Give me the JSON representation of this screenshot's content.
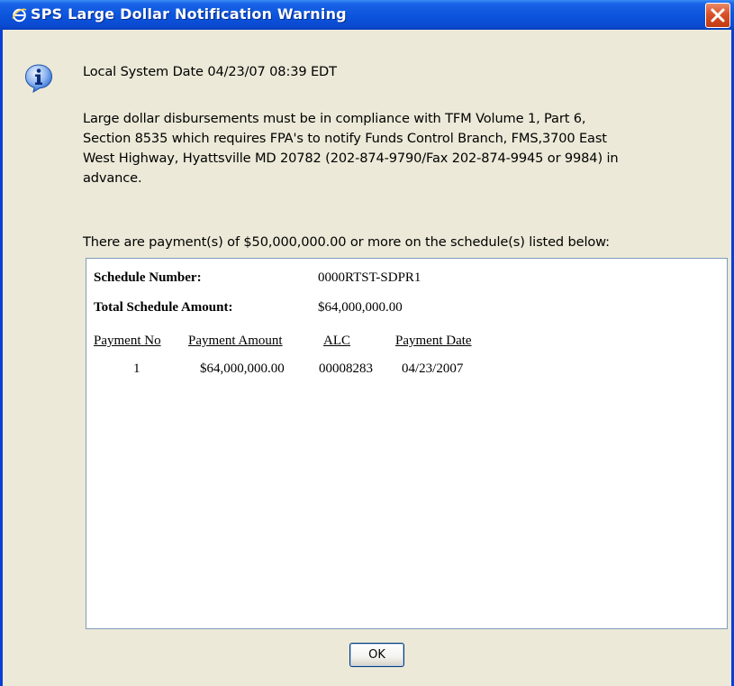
{
  "window": {
    "title": "SPS Large Dollar Notification Warning",
    "title_icon": "internet-explorer-icon",
    "close_icon": "close-icon"
  },
  "dialog": {
    "icon": "info-icon",
    "system_date": "Local System Date 04/23/07 08:39 EDT",
    "compliance_lines": [
      "Large dollar disbursements must be in compliance with TFM Volume 1, Part 6,",
      "Section 8535 which requires FPA's to notify Funds Control Branch, FMS,3700 East",
      "West Highway, Hyattsville MD 20782 (202-874-9790/Fax 202-874-9945 or 9984) in",
      "advance."
    ],
    "payments_intro": "There are payment(s) of $50,000,000.00 or more on the schedule(s) listed below:",
    "ok_label": "OK"
  },
  "schedule": {
    "number_label": "Schedule Number:",
    "number_value": "0000RTST-SDPR1",
    "total_label": "Total Schedule Amount:",
    "total_value": "$64,000,000.00",
    "columns": [
      "Payment No",
      "Payment Amount",
      "ALC",
      "Payment Date"
    ],
    "rows": [
      {
        "payment_no": "1",
        "payment_amount": "$64,000,000.00",
        "alc": "00008283",
        "payment_date": "04/23/2007"
      }
    ]
  },
  "colors": {
    "titlebar": "#0c55dd",
    "window_bg": "#ece9d8",
    "close_red": "#d9512a",
    "info_blue": "#2a6cd6"
  }
}
